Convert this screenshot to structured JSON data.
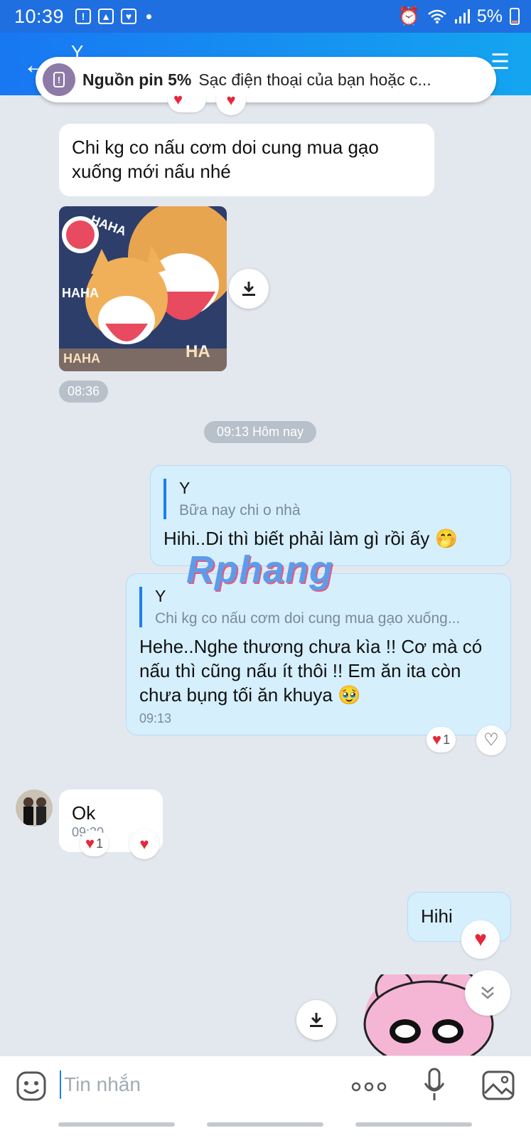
{
  "status_bar": {
    "time": "10:39",
    "battery": "5%"
  },
  "header": {
    "contact_name": "Y"
  },
  "notification": {
    "title": "Nguồn pin 5%",
    "body": "Sạc điện thoại của bạn hoặc c..."
  },
  "messages": {
    "m1": {
      "text": "Chi kg  co nấu cơm doi cung mua gạo xuống mới nấu nhé"
    },
    "sticker_time": "08:36",
    "date_divider": "09:13 Hôm nay",
    "m2": {
      "quote_name": "Y",
      "quote_text": "Bữa nay chi o nhà",
      "text": "Hihi..Di thì biết phải làm gì rồi ấy 🤭"
    },
    "m3": {
      "quote_name": "Y",
      "quote_text": "Chi kg  co nấu cơm doi cung mua gạo xuống...",
      "text": "Hehe..Nghe thương chưa kìa !! Cơ mà có nấu thì cũng nấu ít thôi !! Em ăn ita còn chưa bụng tối ăn khuya 🥹",
      "time": "09:13",
      "reaction_count": "1"
    },
    "m4": {
      "text": "Ok",
      "time": "09:20",
      "reaction_count": "1"
    },
    "m5": {
      "text": "Hihi"
    }
  },
  "input": {
    "placeholder": "Tin nhắn"
  },
  "watermark": "Rphang",
  "colors": {
    "header_start": "#1877f2",
    "header_end": "#14a5f0",
    "outgoing_bubble": "#d5effd",
    "incoming_bubble": "#ffffff",
    "chat_background": "#e3e8ee",
    "heart": "#e5283a"
  },
  "icons": {
    "back": "back-arrow-icon",
    "download": "download-icon",
    "emoji": "emoji-icon",
    "more": "more-icon",
    "mic": "mic-icon",
    "image": "image-icon",
    "scroll_down": "chevron-double-down-icon"
  }
}
